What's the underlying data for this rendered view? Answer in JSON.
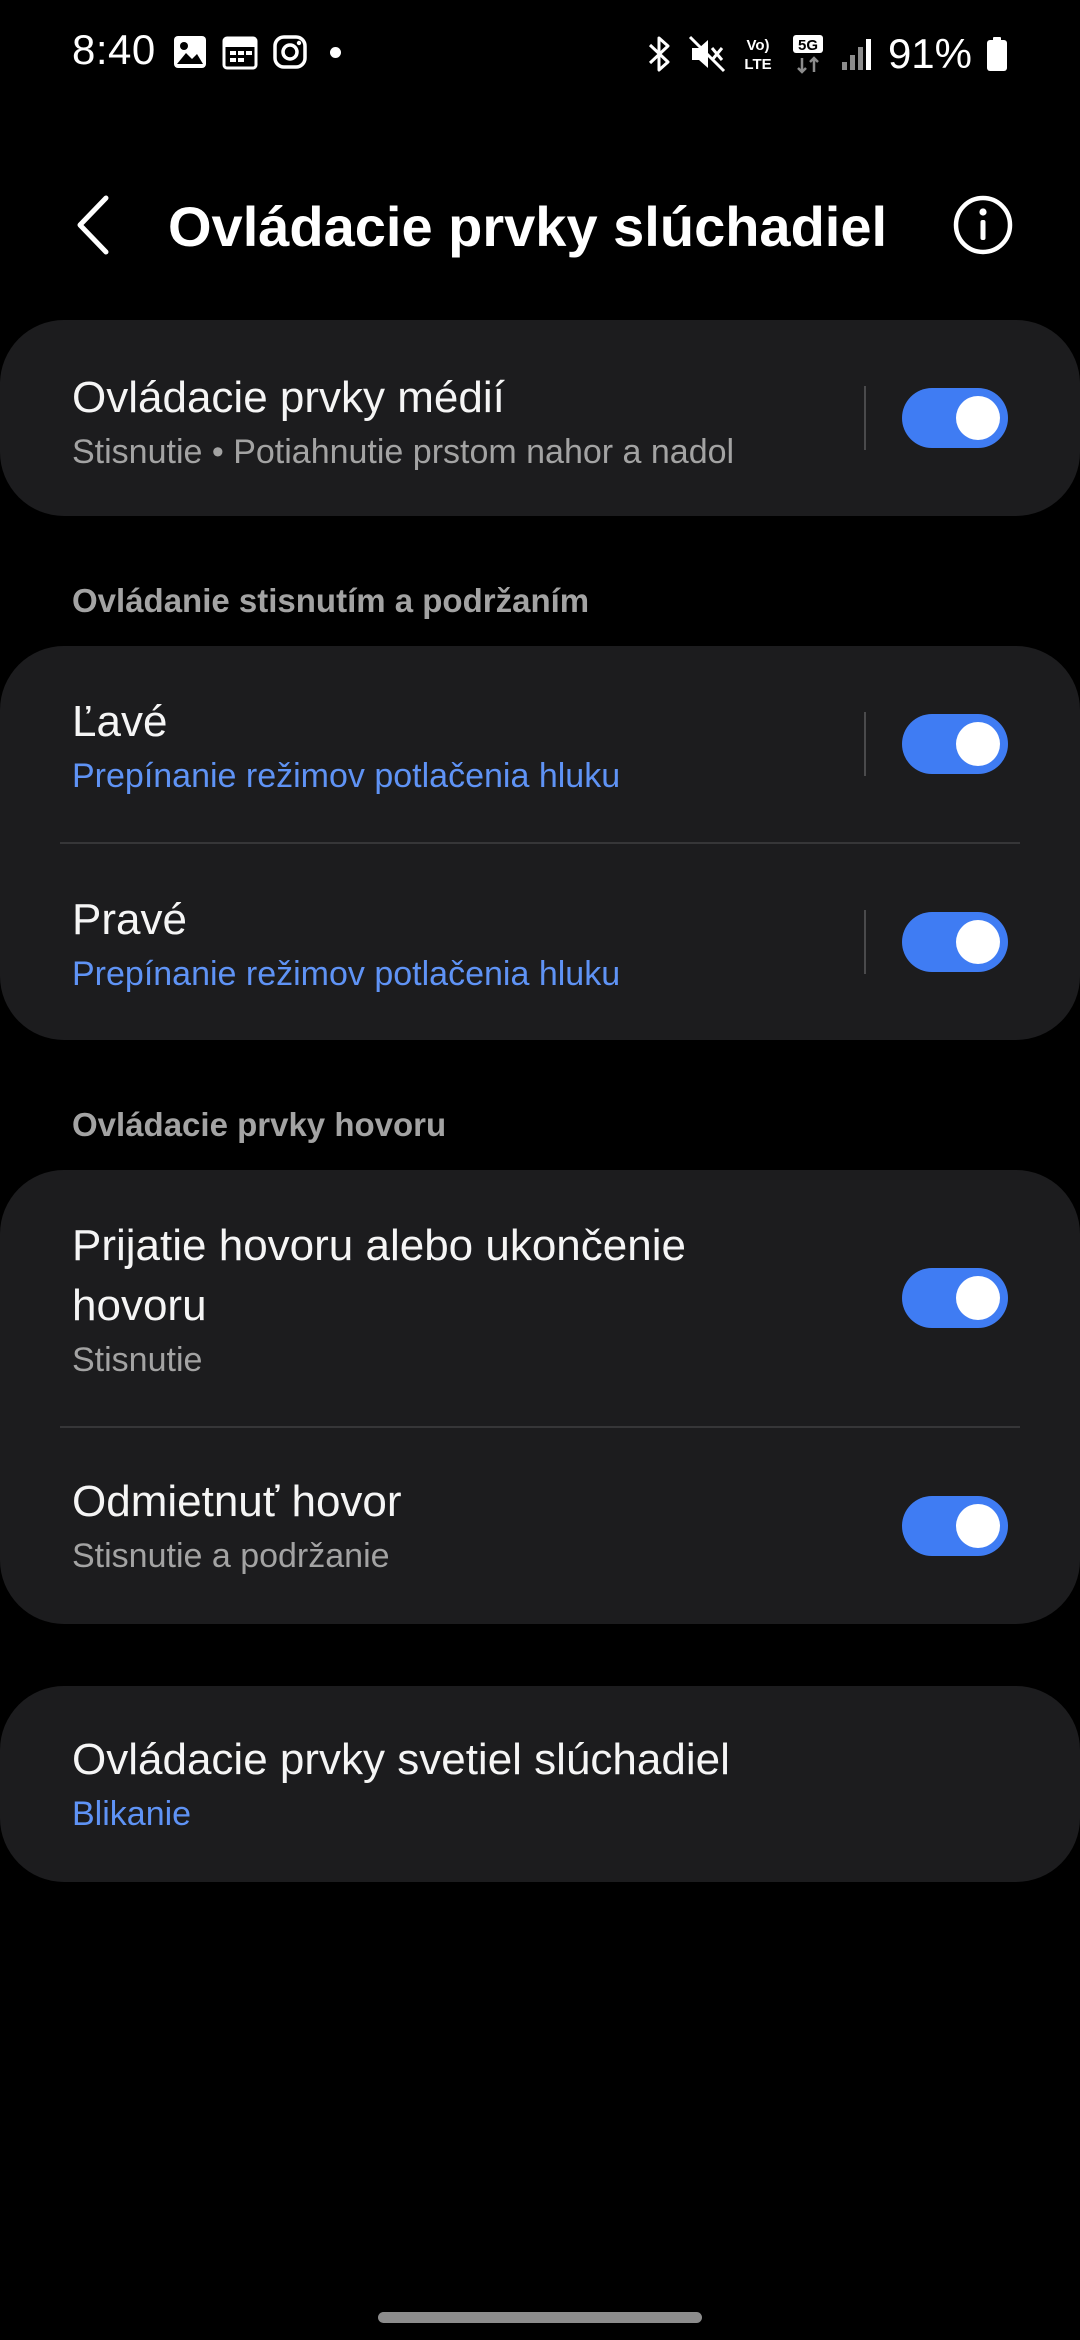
{
  "status_bar": {
    "time": "8:40",
    "left_icons": [
      "gallery-icon",
      "calendar-icon",
      "instagram-icon",
      "notification-dot"
    ],
    "right_icons": [
      "bluetooth-icon",
      "mute-icon",
      "volte-icon",
      "5g-icon",
      "signal-icon",
      "battery-icon"
    ],
    "volte_label_top": "Vo)",
    "volte_label_bottom": "LTE",
    "network_label": "5G",
    "battery_percent": "91%"
  },
  "header": {
    "back_icon": "chevron-left-icon",
    "title": "Ovládacie prvky slúchadiel",
    "info_icon": "info-icon"
  },
  "media_controls": {
    "title": "Ovládacie prvky médií",
    "subtitle": "Stisnutie • Potiahnutie prstom nahor a nadol",
    "enabled": true
  },
  "press_hold_section": {
    "header": "Ovládanie stisnutím a podržaním",
    "items": [
      {
        "title": "Ľavé",
        "subtitle": "Prepínanie režimov potlačenia hluku",
        "enabled": true
      },
      {
        "title": "Pravé",
        "subtitle": "Prepínanie režimov potlačenia hluku",
        "enabled": true
      }
    ]
  },
  "call_section": {
    "header": "Ovládacie prvky hovoru",
    "items": [
      {
        "title_line1": "Prijatie hovoru alebo ukončenie",
        "title_line2": "hovoru",
        "subtitle": "Stisnutie",
        "enabled": true
      },
      {
        "title": "Odmietnuť hovor",
        "subtitle": "Stisnutie a podržanie",
        "enabled": true
      }
    ]
  },
  "light_controls": {
    "title": "Ovládacie prvky svetiel slúchadiel",
    "subtitle": "Blikanie"
  },
  "colors": {
    "background": "#000000",
    "card": "#1c1c1e",
    "accent": "#3f7cf3",
    "accent_text": "#5f93f5",
    "secondary_text": "#a3a3a3"
  }
}
